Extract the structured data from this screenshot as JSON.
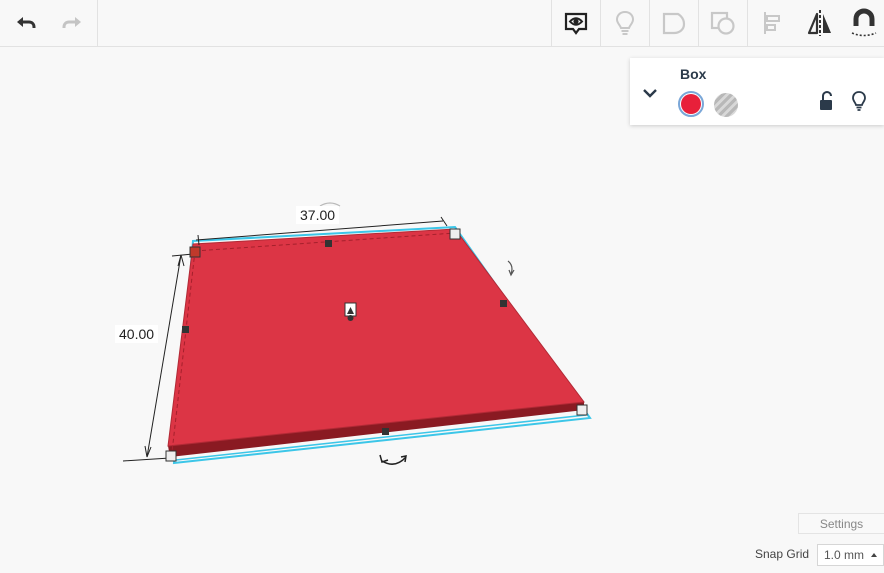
{
  "toolbar": {
    "buttons": [
      {
        "name": "undo-button",
        "icon": "undo-icon",
        "enabled": true
      },
      {
        "name": "redo-button",
        "icon": "redo-icon",
        "enabled": false
      },
      {
        "name": "show-all-button",
        "icon": "eye-icon",
        "enabled": true
      },
      {
        "name": "toggle-visibility-button",
        "icon": "lightbulb-icon",
        "enabled": false
      },
      {
        "name": "group-button",
        "icon": "group-icon",
        "enabled": false
      },
      {
        "name": "ungroup-button",
        "icon": "ungroup-icon",
        "enabled": false
      },
      {
        "name": "align-button",
        "icon": "align-icon",
        "enabled": false
      },
      {
        "name": "mirror-button",
        "icon": "mirror-icon",
        "enabled": true
      },
      {
        "name": "cruise-button",
        "icon": "magnet-icon",
        "enabled": true
      }
    ]
  },
  "shape_panel": {
    "title": "Box",
    "solid_color": "#e8203a",
    "options": [
      "solid",
      "hole"
    ]
  },
  "canvas": {
    "shape": {
      "color": "#dc3545",
      "edge_color": "#8a1a22",
      "selection_color": "#3cc6e8"
    },
    "dimensions": {
      "width": "37.00",
      "length": "40.00"
    }
  },
  "footer": {
    "settings_label": "Settings",
    "snap_grid_label": "Snap Grid",
    "snap_grid_value": "1.0 mm"
  }
}
